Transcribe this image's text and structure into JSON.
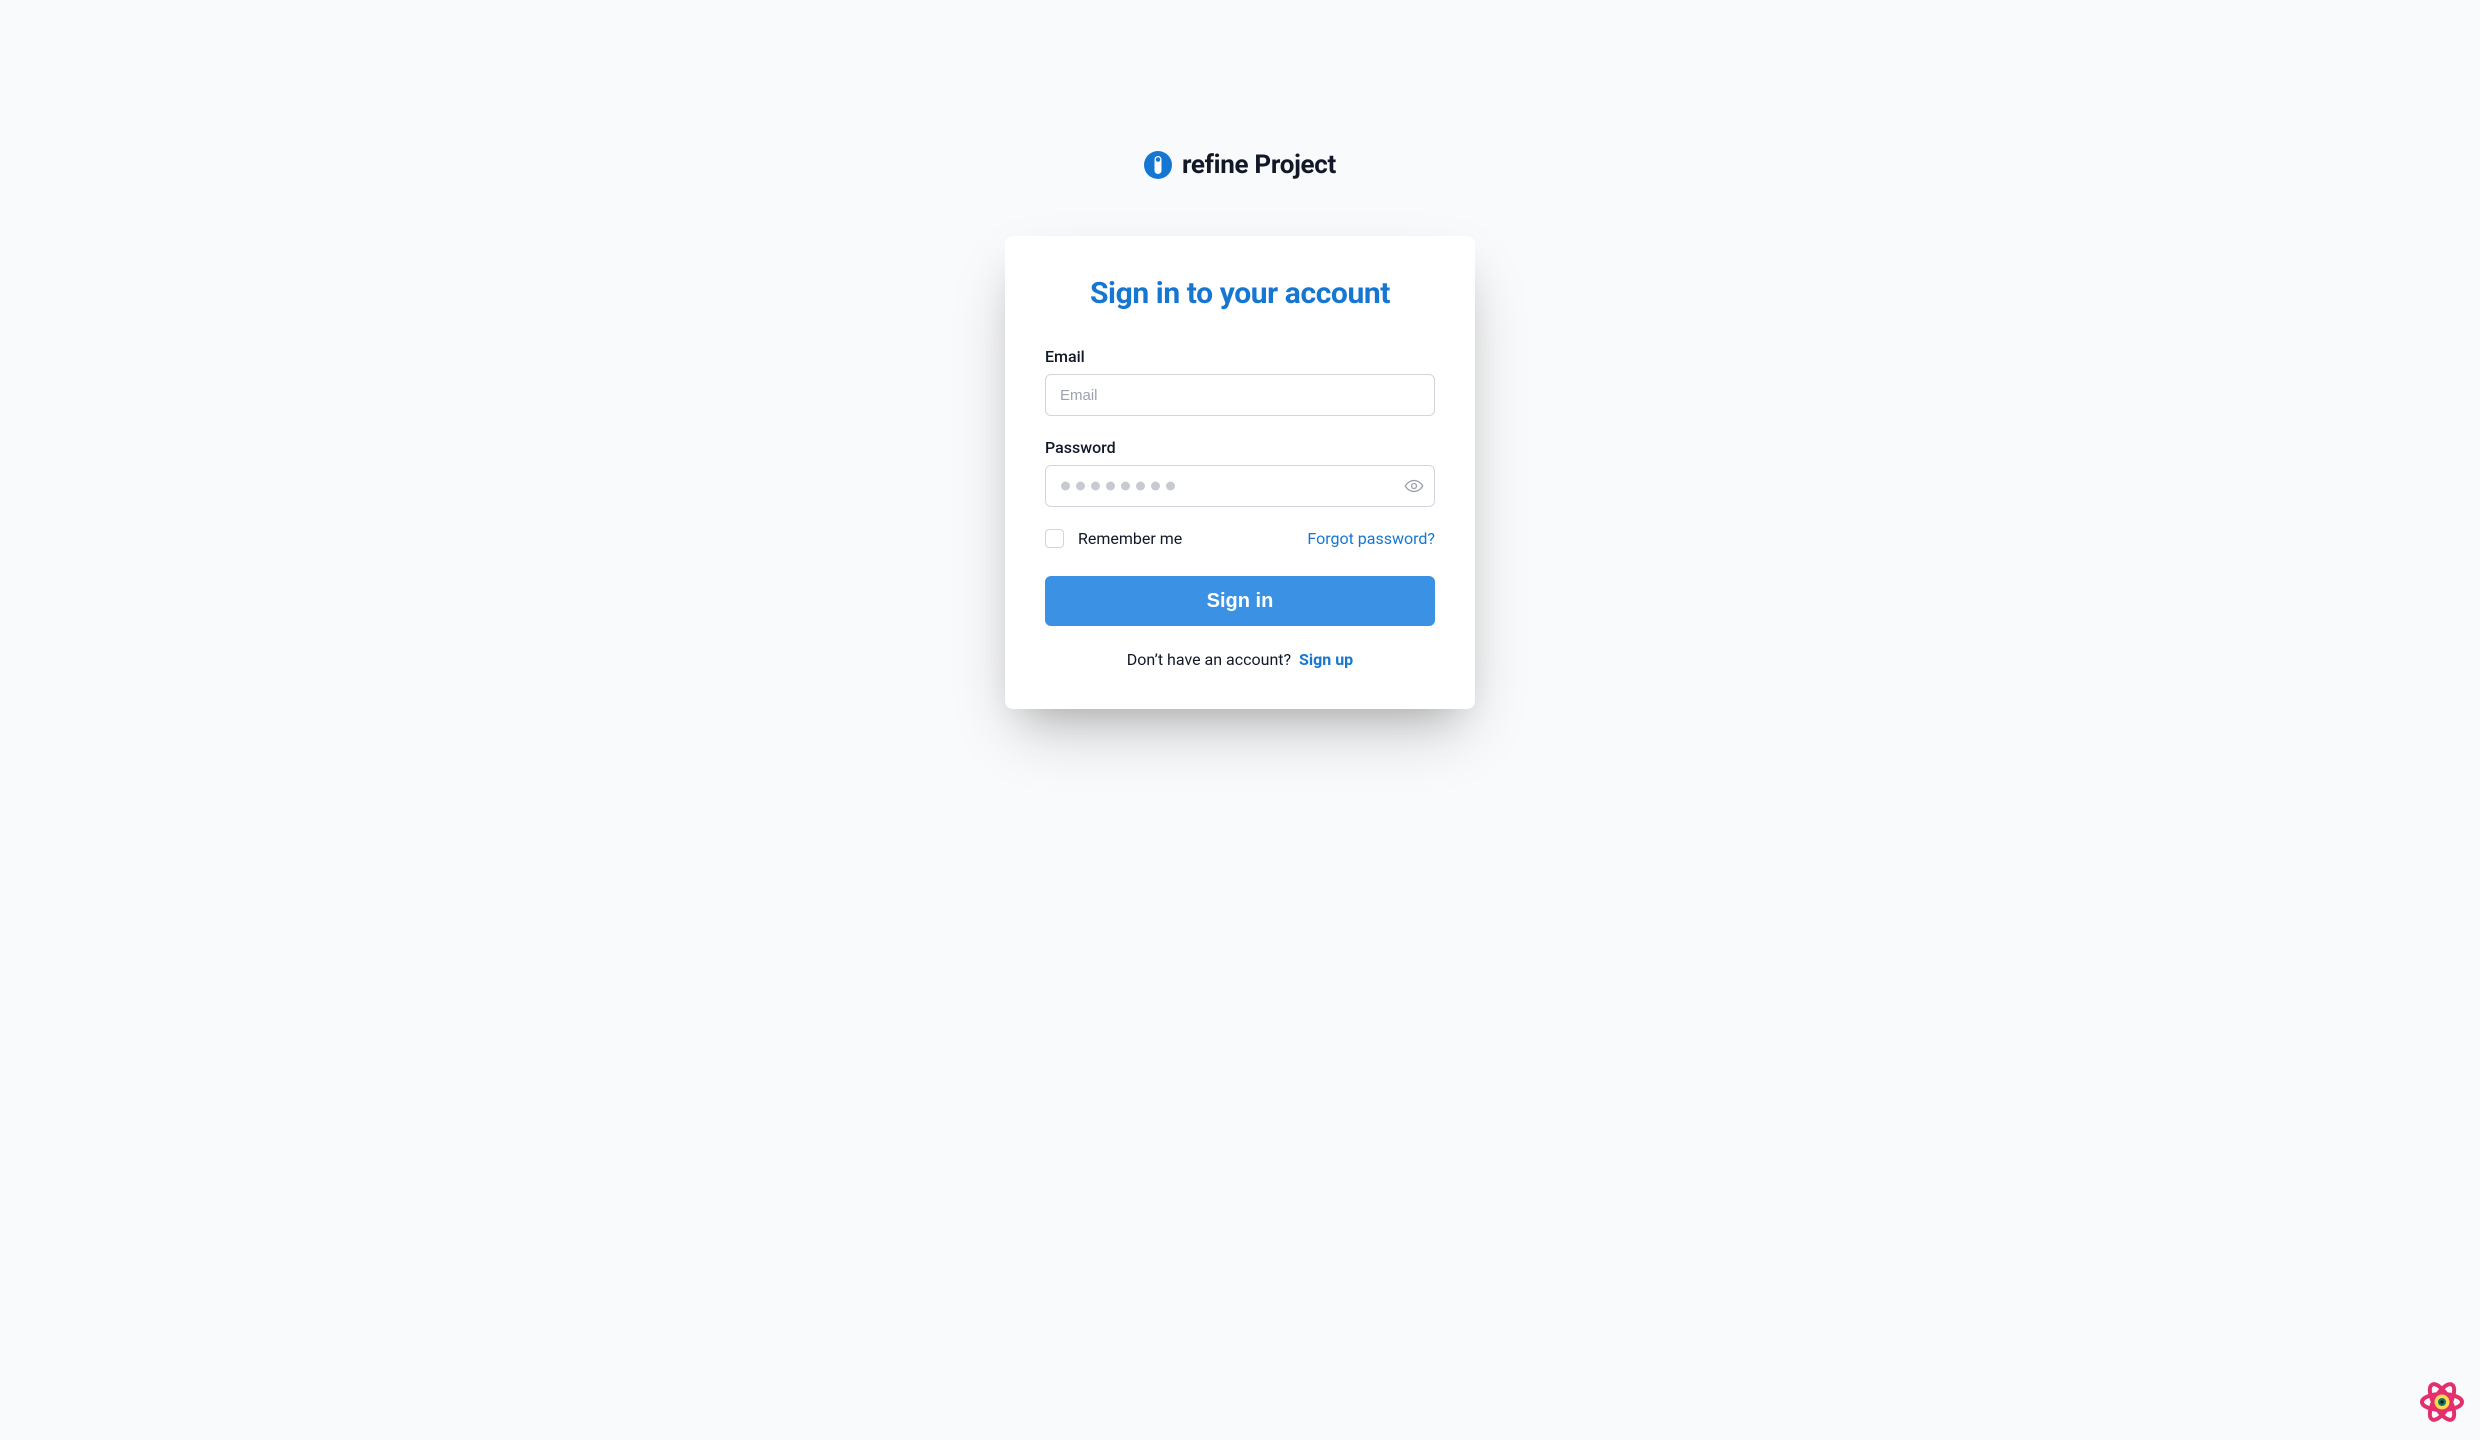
{
  "brand": {
    "title": "refine Project",
    "accent": "#1677d2"
  },
  "card": {
    "title": "Sign in to your account"
  },
  "fields": {
    "email": {
      "label": "Email",
      "placeholder": "Email",
      "value": ""
    },
    "password": {
      "label": "Password",
      "placeholder": "●●●●●●●●",
      "value": ""
    }
  },
  "options": {
    "remember_label": "Remember me",
    "forgot_label": "Forgot password?"
  },
  "actions": {
    "signin_label": "Sign in"
  },
  "signup": {
    "prompt": "Don’t have an account?",
    "link_label": "Sign up"
  },
  "icons": {
    "brand": "refine-logo-icon",
    "eye": "eye-icon",
    "devtools": "react-query-devtools-icon"
  }
}
